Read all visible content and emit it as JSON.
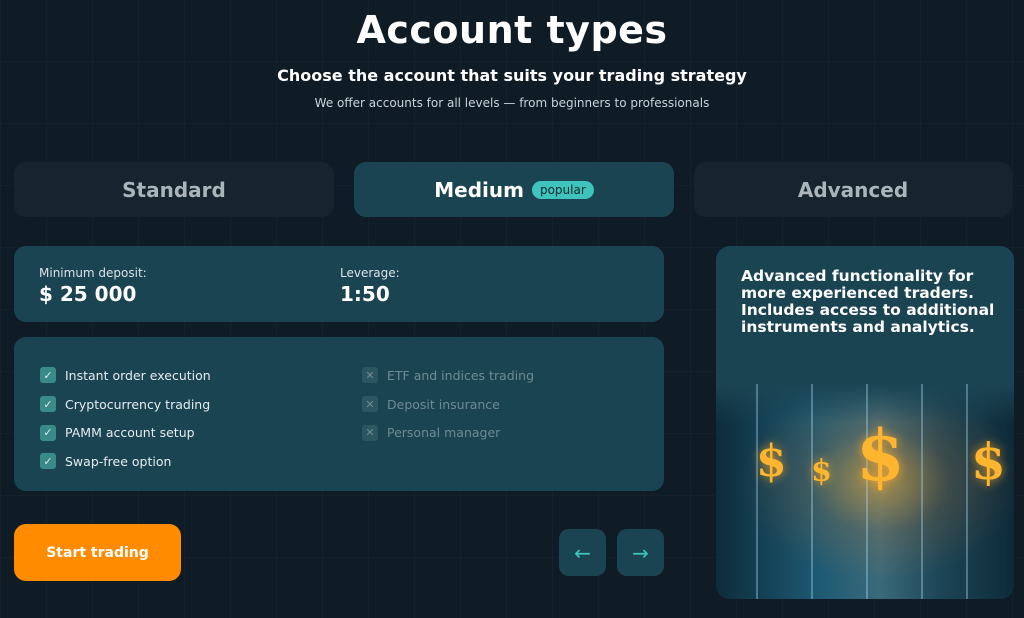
{
  "header": {
    "title": "Account types",
    "subtitle": "Choose the account that suits your trading strategy",
    "description": "We offer accounts for all levels — from beginners to professionals"
  },
  "tabs": [
    {
      "label": "Standard",
      "active": false
    },
    {
      "label": "Medium",
      "active": true,
      "badge": "popular"
    },
    {
      "label": "Advanced",
      "active": false
    }
  ],
  "account": {
    "deposit_label": "Minimum deposit:",
    "deposit_value": "$ 25 000",
    "leverage_label": "Leverage:",
    "leverage_value": "1:50"
  },
  "features_included": [
    "Instant order execution",
    "Cryptocurrency trading",
    "PAMM account setup",
    "Swap-free option"
  ],
  "features_excluded": [
    "ETF and indices trading",
    "Deposit insurance",
    "Personal manager"
  ],
  "actions": {
    "start_label": "Start trading",
    "prev_icon": "←",
    "next_icon": "→"
  },
  "advanced_card": {
    "text": "Advanced functionality for more experienced traders. Includes access to additional instruments and analytics.",
    "image_icon": "dollar-signs-image"
  },
  "colors": {
    "background": "#0f1c26",
    "panel": "#1b4453",
    "accent_teal": "#3fc4bd",
    "button_orange": "#ff8c00"
  }
}
